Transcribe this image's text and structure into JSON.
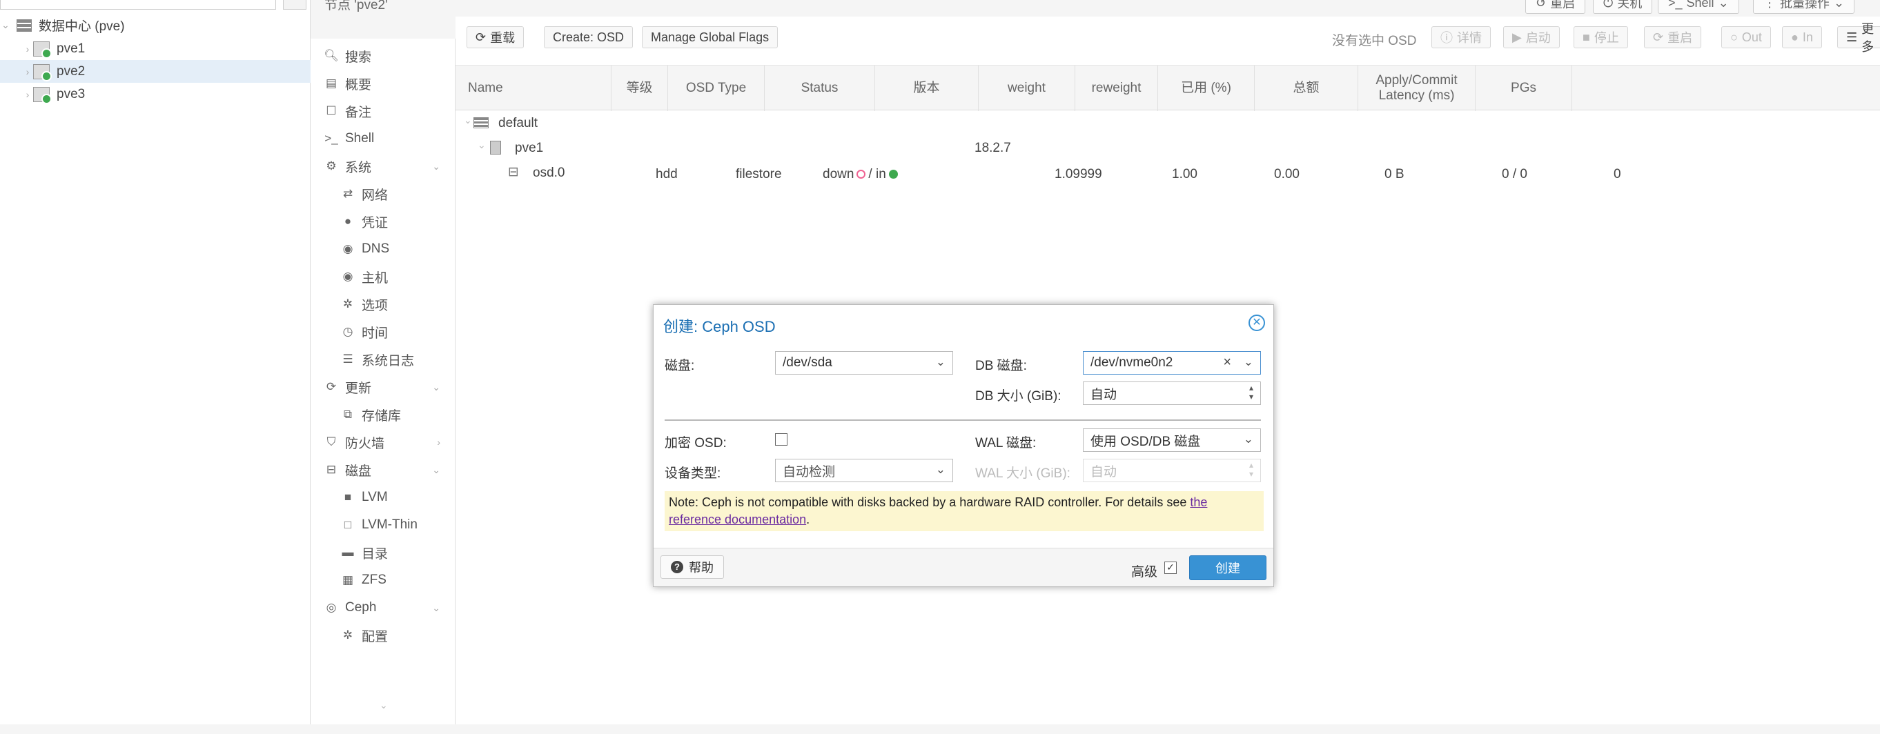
{
  "tree": {
    "datacenter": "数据中心 (pve)",
    "nodes": [
      "pve1",
      "pve2",
      "pve3"
    ],
    "selected": "pve2"
  },
  "header": {
    "node_title": "节点 'pve2'",
    "buttons": [
      "重启",
      "关机",
      "Shell",
      "批量操作"
    ]
  },
  "nav": {
    "items": [
      {
        "icon": "search-icon",
        "label": "搜索"
      },
      {
        "icon": "book-icon",
        "label": "概要"
      },
      {
        "icon": "note-icon",
        "label": "备注"
      },
      {
        "icon": "terminal-icon",
        "label": "Shell"
      },
      {
        "icon": "cogs-icon",
        "label": "系统"
      },
      {
        "icon": "network-icon",
        "label": "网络"
      },
      {
        "icon": "certificate-icon",
        "label": "凭证"
      },
      {
        "icon": "globe-icon",
        "label": "DNS"
      },
      {
        "icon": "globe-icon",
        "label": "主机"
      },
      {
        "icon": "gear-icon",
        "label": "选项"
      },
      {
        "icon": "clock-icon",
        "label": "时间"
      },
      {
        "icon": "list-icon",
        "label": "系统日志"
      },
      {
        "icon": "refresh-icon",
        "label": "更新"
      },
      {
        "icon": "files-icon",
        "label": "存储库"
      },
      {
        "icon": "shield-icon",
        "label": "防火墙"
      },
      {
        "icon": "disk-icon",
        "label": "磁盘"
      },
      {
        "icon": "square-icon",
        "label": "LVM"
      },
      {
        "icon": "square-outline-icon",
        "label": "LVM-Thin"
      },
      {
        "icon": "folder-icon",
        "label": "目录"
      },
      {
        "icon": "grid-icon",
        "label": "ZFS"
      },
      {
        "icon": "ceph-icon",
        "label": "Ceph"
      },
      {
        "icon": "gear-icon",
        "label": "配置"
      }
    ]
  },
  "toolbar": {
    "reload": "重载",
    "create_osd": "Create: OSD",
    "manage_flags": "Manage Global Flags",
    "no_osd_selected": "没有选中 OSD",
    "details": "详情",
    "start": "启动",
    "stop": "停止",
    "restart": "重启",
    "out": "Out",
    "in": "In",
    "more": "更多"
  },
  "grid": {
    "columns": [
      "Name",
      "等级",
      "OSD Type",
      "Status",
      "版本",
      "weight",
      "reweight",
      "已用 (%)",
      "总额",
      "Apply/Commit Latency (ms)",
      "PGs"
    ],
    "root": "default",
    "host": {
      "name": "pve1",
      "version": "18.2.7"
    },
    "osd": {
      "name": "osd.0",
      "class": "hdd",
      "type": "filestore",
      "status_down": "down",
      "status_in": "/ in",
      "weight": "1.09999",
      "reweight": "1.00",
      "used": "0.00",
      "total": "0 B",
      "latency": "0 / 0",
      "pgs": "0"
    },
    "status_colors": {
      "down": "#f06292",
      "in": "#3ea94f"
    }
  },
  "dialog": {
    "title": "创建: Ceph OSD",
    "disk_label": "磁盘:",
    "disk_value": "/dev/sda",
    "db_disk_label": "DB 磁盘:",
    "db_disk_value": "/dev/nvme0n2",
    "db_size_label": "DB 大小 (GiB):",
    "db_size_value": "自动",
    "encrypt_label": "加密 OSD:",
    "wal_disk_label": "WAL 磁盘:",
    "wal_disk_value": "使用 OSD/DB 磁盘",
    "device_class_label": "设备类型:",
    "device_class_value": "自动检测",
    "wal_size_label": "WAL 大小 (GiB):",
    "wal_size_value": "自动",
    "note_text": "Note: Ceph is not compatible with disks backed by a hardware RAID controller. For details see ",
    "note_link_1": "the",
    "note_link_2": "reference documentation",
    "note_end": ".",
    "help": "帮助",
    "advanced": "高级",
    "create": "创建",
    "accent": "#3892d4"
  }
}
